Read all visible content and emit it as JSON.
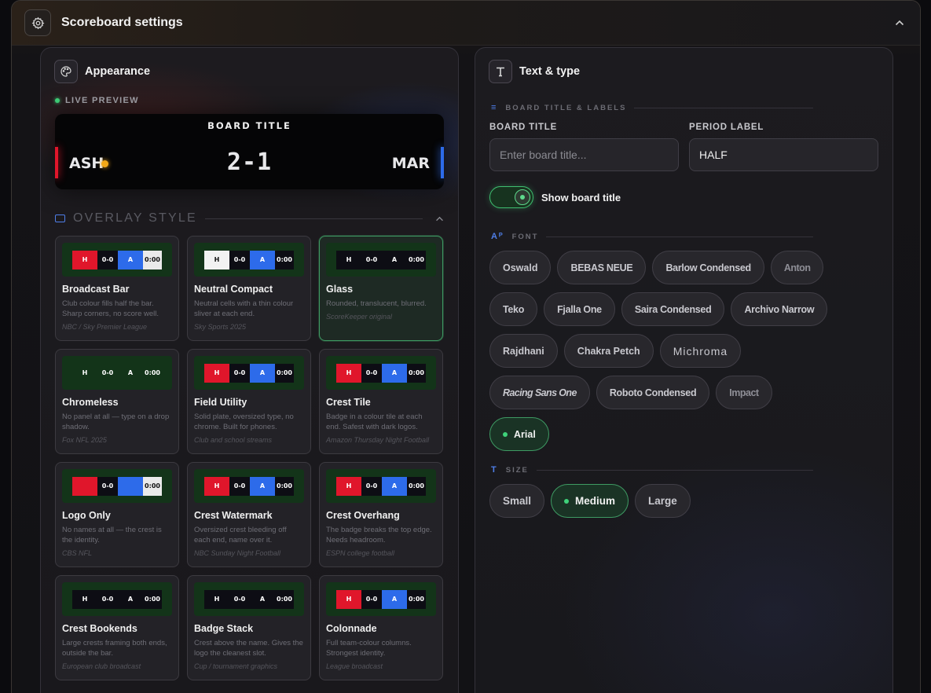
{
  "header": {
    "title": "Scoreboard settings"
  },
  "appearance": {
    "title": "Appearance",
    "live_preview": "LIVE PREVIEW",
    "preview": {
      "board_title": "BOARD TITLE",
      "home": "ASH",
      "score": "2-1",
      "away": "MAR"
    },
    "overlay_section": "OVERLAY STYLE",
    "styles": [
      {
        "name": "Broadcast Bar",
        "desc": "Club colour fills half the bar. Sharp corners, no score well.",
        "source": "NBC / Sky Premier League",
        "selected": false
      },
      {
        "name": "Neutral Compact",
        "desc": "Neutral cells with a thin colour sliver at each end.",
        "source": "Sky Sports 2025",
        "selected": false
      },
      {
        "name": "Glass",
        "desc": "Rounded, translucent, blurred.",
        "source": "ScoreKeeper original",
        "selected": true
      },
      {
        "name": "Chromeless",
        "desc": "No panel at all — type on a drop shadow.",
        "source": "Fox NFL 2025",
        "selected": false
      },
      {
        "name": "Field Utility",
        "desc": "Solid plate, oversized type, no chrome. Built for phones.",
        "source": "Club and school streams",
        "selected": false
      },
      {
        "name": "Crest Tile",
        "desc": "Badge in a colour tile at each end. Safest with dark logos.",
        "source": "Amazon Thursday Night Football",
        "selected": false
      },
      {
        "name": "Logo Only",
        "desc": "No names at all — the crest is the identity.",
        "source": "CBS NFL",
        "selected": false
      },
      {
        "name": "Crest Watermark",
        "desc": "Oversized crest bleeding off each end, name over it.",
        "source": "NBC Sunday Night Football",
        "selected": false
      },
      {
        "name": "Crest Overhang",
        "desc": "The badge breaks the top edge. Needs headroom.",
        "source": "ESPN college football",
        "selected": false
      },
      {
        "name": "Crest Bookends",
        "desc": "Large crests framing both ends, outside the bar.",
        "source": "European club broadcast",
        "selected": false
      },
      {
        "name": "Badge Stack",
        "desc": "Crest above the name. Gives the logo the cleanest slot.",
        "source": "Cup / tournament graphics",
        "selected": false
      },
      {
        "name": "Colonnade",
        "desc": "Full team-colour columns. Strongest identity.",
        "source": "League broadcast",
        "selected": false
      }
    ],
    "thumb_text": {
      "home": "H",
      "score": "0-0",
      "away": "A",
      "clock": "0:00"
    },
    "colors": {
      "home": "#e0162b",
      "away": "#2d6bea",
      "thumb_bg": "#133419",
      "accent": "#3fd27a"
    }
  },
  "text_type": {
    "title": "Text & type",
    "section_labels": "BOARD TITLE & LABELS",
    "board_title_label": "BOARD TITLE",
    "board_title_placeholder": "Enter board title...",
    "period_label_label": "PERIOD LABEL",
    "period_label_value": "HALF",
    "show_board_title": "Show board title",
    "show_board_title_on": true,
    "font_section": "FONT",
    "fonts": [
      {
        "label": "Oswald",
        "selected": false
      },
      {
        "label": "BEBAS NEUE",
        "selected": false
      },
      {
        "label": "Barlow Condensed",
        "selected": false
      },
      {
        "label": "Anton",
        "selected": false
      },
      {
        "label": "Teko",
        "selected": false
      },
      {
        "label": "Fjalla One",
        "selected": false
      },
      {
        "label": "Saira Condensed",
        "selected": false
      },
      {
        "label": "Archivo Narrow",
        "selected": false
      },
      {
        "label": "Rajdhani",
        "selected": false
      },
      {
        "label": "Chakra Petch",
        "selected": false
      },
      {
        "label": "Michroma",
        "selected": false
      },
      {
        "label": "Racing Sans One",
        "selected": false
      },
      {
        "label": "Roboto Condensed",
        "selected": false
      },
      {
        "label": "Impact",
        "selected": false
      },
      {
        "label": "Arial",
        "selected": true
      }
    ],
    "size_section": "SIZE",
    "sizes": [
      {
        "label": "Small",
        "selected": false
      },
      {
        "label": "Medium",
        "selected": true
      },
      {
        "label": "Large",
        "selected": false
      }
    ]
  }
}
